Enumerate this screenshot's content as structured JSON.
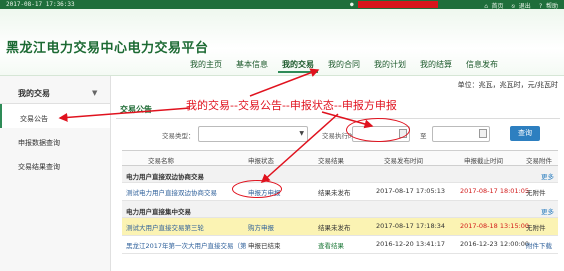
{
  "topbar": {
    "datetime": "2017-08-17 17:36:33",
    "user_icon": "user-icon",
    "links": [
      "首页",
      "退出",
      "帮助"
    ]
  },
  "header": {
    "title": "黑龙江电力交易中心电力交易平台",
    "nav": [
      "我的主页",
      "基本信息",
      "我的交易",
      "我的合同",
      "我的计划",
      "我的结算",
      "信息发布"
    ]
  },
  "sidebar": {
    "title": "我的交易",
    "items": [
      "交易公告",
      "申报数据查询",
      "交易结果查询"
    ]
  },
  "content": {
    "unit_note": "单位：兆瓦，兆瓦时，元/兆瓦时",
    "section_title": "交易公告",
    "filters": {
      "type_label": "交易类型：",
      "date_label": "交易执行时间：",
      "to_label": "至",
      "search_label": "查询"
    },
    "table": {
      "headers": [
        "交易名称",
        "申报状态",
        "交易结果",
        "交易发布时间",
        "申报截止时间",
        "交易附件"
      ],
      "more_label": "更多",
      "groups": [
        {
          "name": "电力用户直接双边协商交易",
          "rows": [
            [
              "测试电力用户直接双边协商交易",
              "申报方申报",
              "结果未发布",
              "2017-08-17 17:05:13",
              "2017-08-17 18:01:05",
              "无附件"
            ]
          ]
        },
        {
          "name": "电力用户直接集中交易",
          "rows": [
            [
              "测试大用户直接交易第三轮",
              "购方申报",
              "结果未发布",
              "2017-08-17 17:18:34",
              "2017-08-18 13:15:00",
              "无附件"
            ],
            [
              "黑龙江2017年第一次大用户直接交易（第3轮）",
              "申报已结束",
              "查看结果",
              "2016-12-20 13:41:17",
              "2016-12-23 12:00:00",
              "附件下载"
            ]
          ]
        }
      ]
    }
  },
  "annotation": {
    "text": "我的交易--交易公告--申报状态--申报方申报",
    "color": "#e0121e"
  },
  "colors": {
    "brand_green": "#1f6e3b",
    "accent_blue": "#2d7fc0",
    "highlight_row": "#fbf3b3"
  }
}
